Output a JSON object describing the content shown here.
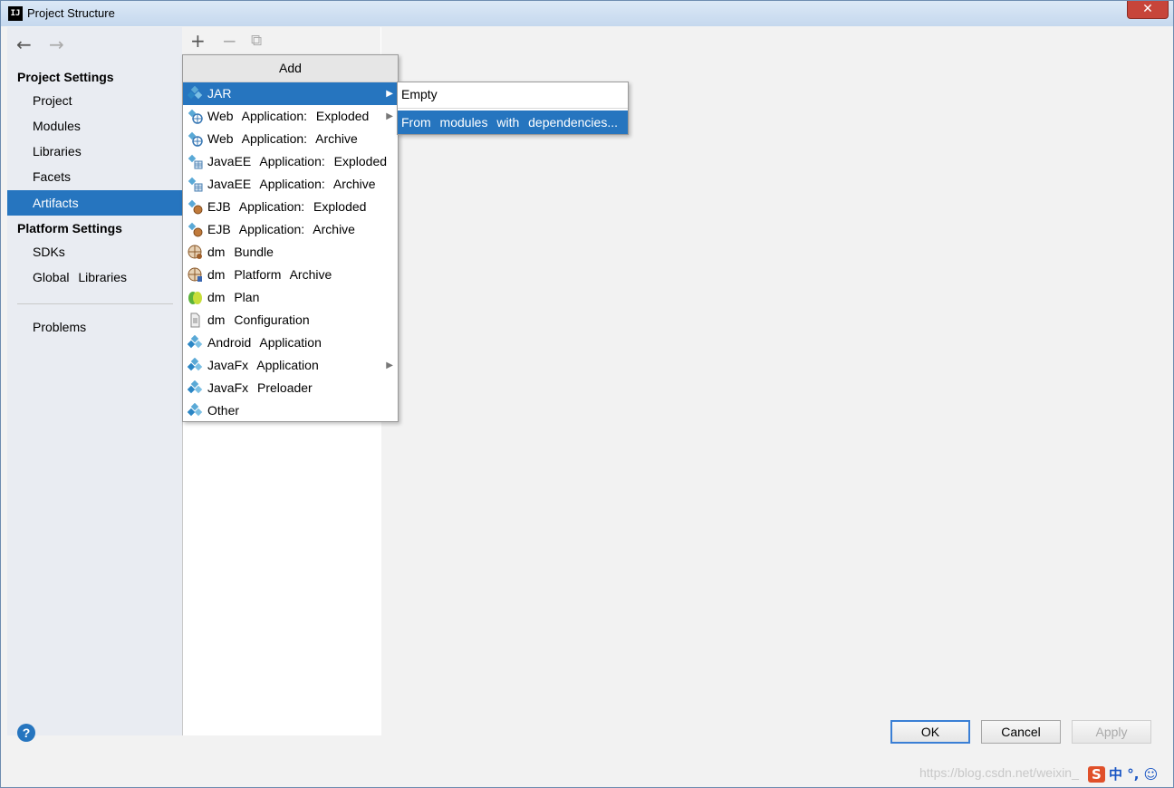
{
  "window": {
    "title": "Project Structure",
    "close": "✕"
  },
  "nav": {
    "back": "←",
    "forward": "→"
  },
  "toolbar": {
    "add": "+",
    "remove": "−",
    "copy": "⧉"
  },
  "sidebar": {
    "project_settings_label": "Project Settings",
    "project_items": [
      "Project",
      "Modules",
      "Libraries",
      "Facets",
      "Artifacts"
    ],
    "selected": "Artifacts",
    "platform_settings_label": "Platform Settings",
    "platform_items": [
      "SDKs",
      "Global Libraries"
    ],
    "problems": "Problems"
  },
  "add_menu": {
    "header": "Add",
    "items": [
      {
        "label": "JAR",
        "icon": "jar-icon",
        "has_submenu": true
      },
      {
        "label": "Web Application: Exploded",
        "icon": "web-app-icon",
        "has_submenu": true
      },
      {
        "label": "Web Application: Archive",
        "icon": "web-app-icon",
        "has_submenu": false
      },
      {
        "label": "JavaEE Application: Exploded",
        "icon": "javaee-icon",
        "has_submenu": false
      },
      {
        "label": "JavaEE Application: Archive",
        "icon": "javaee-icon",
        "has_submenu": false
      },
      {
        "label": "EJB Application: Exploded",
        "icon": "ejb-icon",
        "has_submenu": false
      },
      {
        "label": "EJB Application: Archive",
        "icon": "ejb-icon",
        "has_submenu": false
      },
      {
        "label": "dm Bundle",
        "icon": "dm-bundle-icon",
        "has_submenu": false
      },
      {
        "label": "dm Platform Archive",
        "icon": "dm-platform-icon",
        "has_submenu": false
      },
      {
        "label": "dm Plan",
        "icon": "dm-plan-icon",
        "has_submenu": false
      },
      {
        "label": "dm Configuration",
        "icon": "document-icon",
        "has_submenu": false
      },
      {
        "label": "Android Application",
        "icon": "android-icon",
        "has_submenu": false
      },
      {
        "label": "JavaFx Application",
        "icon": "javafx-icon",
        "has_submenu": true
      },
      {
        "label": "JavaFx Preloader",
        "icon": "javafx-icon",
        "has_submenu": false
      },
      {
        "label": "Other",
        "icon": "artifact-icon",
        "has_submenu": false
      }
    ],
    "selected_index": 0
  },
  "jar_submenu": {
    "items": [
      "Empty",
      "From modules with dependencies..."
    ],
    "selected_index": 1
  },
  "buttons": {
    "help": "?",
    "ok": "OK",
    "cancel": "Cancel",
    "apply": "Apply"
  },
  "watermark": "https://blog.csdn.net/weixin_",
  "ime": {
    "logo": "S",
    "text": "中 °, ☺"
  },
  "colors": {
    "selection": "#2675bf",
    "sidebar_bg": "#e9ecf2"
  }
}
